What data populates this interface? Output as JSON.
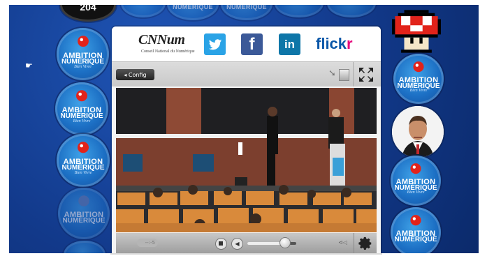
{
  "badges": {
    "title_line1": "AMBITION",
    "title_line2": "NUMÉRIQUE",
    "tagline": "Bien Vivre"
  },
  "top_counter": "204",
  "header": {
    "logo_text": "CNNum",
    "logo_subtitle": "Conseil National du Numérique",
    "social": {
      "twitter": "t",
      "facebook": "f",
      "linkedin": "in",
      "flickr_a": "flick",
      "flickr_b": "r"
    }
  },
  "toolbar": {
    "config_label": "◂ Config"
  },
  "player": {
    "time_display": "--:-5",
    "volume_level": 0.75,
    "cc_label": "⊲◁"
  },
  "colors": {
    "background_blue": "#12398a",
    "bubble_blue": "#1c6fc4",
    "twitter": "#2aa3e6",
    "facebook": "#3b5998",
    "linkedin": "#0e76a8",
    "flickr_blue": "#0b57a8",
    "flickr_pink": "#e5007a"
  },
  "icons": [
    "twitter-icon",
    "facebook-icon",
    "linkedin-icon",
    "pointer-icon",
    "fullscreen-icon",
    "stop-icon",
    "volume-icon",
    "settings-gear-icon",
    "pixel-mushroom-icon"
  ]
}
